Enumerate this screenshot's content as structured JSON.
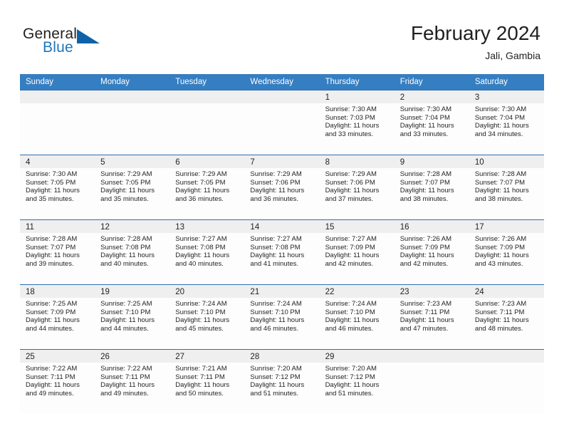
{
  "brand": {
    "name_part1": "General",
    "name_part2": "Blue",
    "triangle_color": "#0f62a8",
    "blue_color": "#1f76bc"
  },
  "header": {
    "title": "February 2024",
    "location": "Jali, Gambia"
  },
  "theme": {
    "header_row_bg": "#357ec1",
    "row_separator": "#2f6fae",
    "day_band_bg": "#efefef",
    "cell_bg": "#fdfdfd",
    "text": "#231f20"
  },
  "weekdays": [
    "Sunday",
    "Monday",
    "Tuesday",
    "Wednesday",
    "Thursday",
    "Friday",
    "Saturday"
  ],
  "weeks": [
    [
      {
        "day": "",
        "sunrise": "",
        "sunset": "",
        "daylight1": "",
        "daylight2": ""
      },
      {
        "day": "",
        "sunrise": "",
        "sunset": "",
        "daylight1": "",
        "daylight2": ""
      },
      {
        "day": "",
        "sunrise": "",
        "sunset": "",
        "daylight1": "",
        "daylight2": ""
      },
      {
        "day": "",
        "sunrise": "",
        "sunset": "",
        "daylight1": "",
        "daylight2": ""
      },
      {
        "day": "1",
        "sunrise": "Sunrise: 7:30 AM",
        "sunset": "Sunset: 7:03 PM",
        "daylight1": "Daylight: 11 hours",
        "daylight2": "and 33 minutes."
      },
      {
        "day": "2",
        "sunrise": "Sunrise: 7:30 AM",
        "sunset": "Sunset: 7:04 PM",
        "daylight1": "Daylight: 11 hours",
        "daylight2": "and 33 minutes."
      },
      {
        "day": "3",
        "sunrise": "Sunrise: 7:30 AM",
        "sunset": "Sunset: 7:04 PM",
        "daylight1": "Daylight: 11 hours",
        "daylight2": "and 34 minutes."
      }
    ],
    [
      {
        "day": "4",
        "sunrise": "Sunrise: 7:30 AM",
        "sunset": "Sunset: 7:05 PM",
        "daylight1": "Daylight: 11 hours",
        "daylight2": "and 35 minutes."
      },
      {
        "day": "5",
        "sunrise": "Sunrise: 7:29 AM",
        "sunset": "Sunset: 7:05 PM",
        "daylight1": "Daylight: 11 hours",
        "daylight2": "and 35 minutes."
      },
      {
        "day": "6",
        "sunrise": "Sunrise: 7:29 AM",
        "sunset": "Sunset: 7:05 PM",
        "daylight1": "Daylight: 11 hours",
        "daylight2": "and 36 minutes."
      },
      {
        "day": "7",
        "sunrise": "Sunrise: 7:29 AM",
        "sunset": "Sunset: 7:06 PM",
        "daylight1": "Daylight: 11 hours",
        "daylight2": "and 36 minutes."
      },
      {
        "day": "8",
        "sunrise": "Sunrise: 7:29 AM",
        "sunset": "Sunset: 7:06 PM",
        "daylight1": "Daylight: 11 hours",
        "daylight2": "and 37 minutes."
      },
      {
        "day": "9",
        "sunrise": "Sunrise: 7:28 AM",
        "sunset": "Sunset: 7:07 PM",
        "daylight1": "Daylight: 11 hours",
        "daylight2": "and 38 minutes."
      },
      {
        "day": "10",
        "sunrise": "Sunrise: 7:28 AM",
        "sunset": "Sunset: 7:07 PM",
        "daylight1": "Daylight: 11 hours",
        "daylight2": "and 38 minutes."
      }
    ],
    [
      {
        "day": "11",
        "sunrise": "Sunrise: 7:28 AM",
        "sunset": "Sunset: 7:07 PM",
        "daylight1": "Daylight: 11 hours",
        "daylight2": "and 39 minutes."
      },
      {
        "day": "12",
        "sunrise": "Sunrise: 7:28 AM",
        "sunset": "Sunset: 7:08 PM",
        "daylight1": "Daylight: 11 hours",
        "daylight2": "and 40 minutes."
      },
      {
        "day": "13",
        "sunrise": "Sunrise: 7:27 AM",
        "sunset": "Sunset: 7:08 PM",
        "daylight1": "Daylight: 11 hours",
        "daylight2": "and 40 minutes."
      },
      {
        "day": "14",
        "sunrise": "Sunrise: 7:27 AM",
        "sunset": "Sunset: 7:08 PM",
        "daylight1": "Daylight: 11 hours",
        "daylight2": "and 41 minutes."
      },
      {
        "day": "15",
        "sunrise": "Sunrise: 7:27 AM",
        "sunset": "Sunset: 7:09 PM",
        "daylight1": "Daylight: 11 hours",
        "daylight2": "and 42 minutes."
      },
      {
        "day": "16",
        "sunrise": "Sunrise: 7:26 AM",
        "sunset": "Sunset: 7:09 PM",
        "daylight1": "Daylight: 11 hours",
        "daylight2": "and 42 minutes."
      },
      {
        "day": "17",
        "sunrise": "Sunrise: 7:26 AM",
        "sunset": "Sunset: 7:09 PM",
        "daylight1": "Daylight: 11 hours",
        "daylight2": "and 43 minutes."
      }
    ],
    [
      {
        "day": "18",
        "sunrise": "Sunrise: 7:25 AM",
        "sunset": "Sunset: 7:09 PM",
        "daylight1": "Daylight: 11 hours",
        "daylight2": "and 44 minutes."
      },
      {
        "day": "19",
        "sunrise": "Sunrise: 7:25 AM",
        "sunset": "Sunset: 7:10 PM",
        "daylight1": "Daylight: 11 hours",
        "daylight2": "and 44 minutes."
      },
      {
        "day": "20",
        "sunrise": "Sunrise: 7:24 AM",
        "sunset": "Sunset: 7:10 PM",
        "daylight1": "Daylight: 11 hours",
        "daylight2": "and 45 minutes."
      },
      {
        "day": "21",
        "sunrise": "Sunrise: 7:24 AM",
        "sunset": "Sunset: 7:10 PM",
        "daylight1": "Daylight: 11 hours",
        "daylight2": "and 46 minutes."
      },
      {
        "day": "22",
        "sunrise": "Sunrise: 7:24 AM",
        "sunset": "Sunset: 7:10 PM",
        "daylight1": "Daylight: 11 hours",
        "daylight2": "and 46 minutes."
      },
      {
        "day": "23",
        "sunrise": "Sunrise: 7:23 AM",
        "sunset": "Sunset: 7:11 PM",
        "daylight1": "Daylight: 11 hours",
        "daylight2": "and 47 minutes."
      },
      {
        "day": "24",
        "sunrise": "Sunrise: 7:23 AM",
        "sunset": "Sunset: 7:11 PM",
        "daylight1": "Daylight: 11 hours",
        "daylight2": "and 48 minutes."
      }
    ],
    [
      {
        "day": "25",
        "sunrise": "Sunrise: 7:22 AM",
        "sunset": "Sunset: 7:11 PM",
        "daylight1": "Daylight: 11 hours",
        "daylight2": "and 49 minutes."
      },
      {
        "day": "26",
        "sunrise": "Sunrise: 7:22 AM",
        "sunset": "Sunset: 7:11 PM",
        "daylight1": "Daylight: 11 hours",
        "daylight2": "and 49 minutes."
      },
      {
        "day": "27",
        "sunrise": "Sunrise: 7:21 AM",
        "sunset": "Sunset: 7:11 PM",
        "daylight1": "Daylight: 11 hours",
        "daylight2": "and 50 minutes."
      },
      {
        "day": "28",
        "sunrise": "Sunrise: 7:20 AM",
        "sunset": "Sunset: 7:12 PM",
        "daylight1": "Daylight: 11 hours",
        "daylight2": "and 51 minutes."
      },
      {
        "day": "29",
        "sunrise": "Sunrise: 7:20 AM",
        "sunset": "Sunset: 7:12 PM",
        "daylight1": "Daylight: 11 hours",
        "daylight2": "and 51 minutes."
      },
      {
        "day": "",
        "sunrise": "",
        "sunset": "",
        "daylight1": "",
        "daylight2": ""
      },
      {
        "day": "",
        "sunrise": "",
        "sunset": "",
        "daylight1": "",
        "daylight2": ""
      }
    ]
  ]
}
